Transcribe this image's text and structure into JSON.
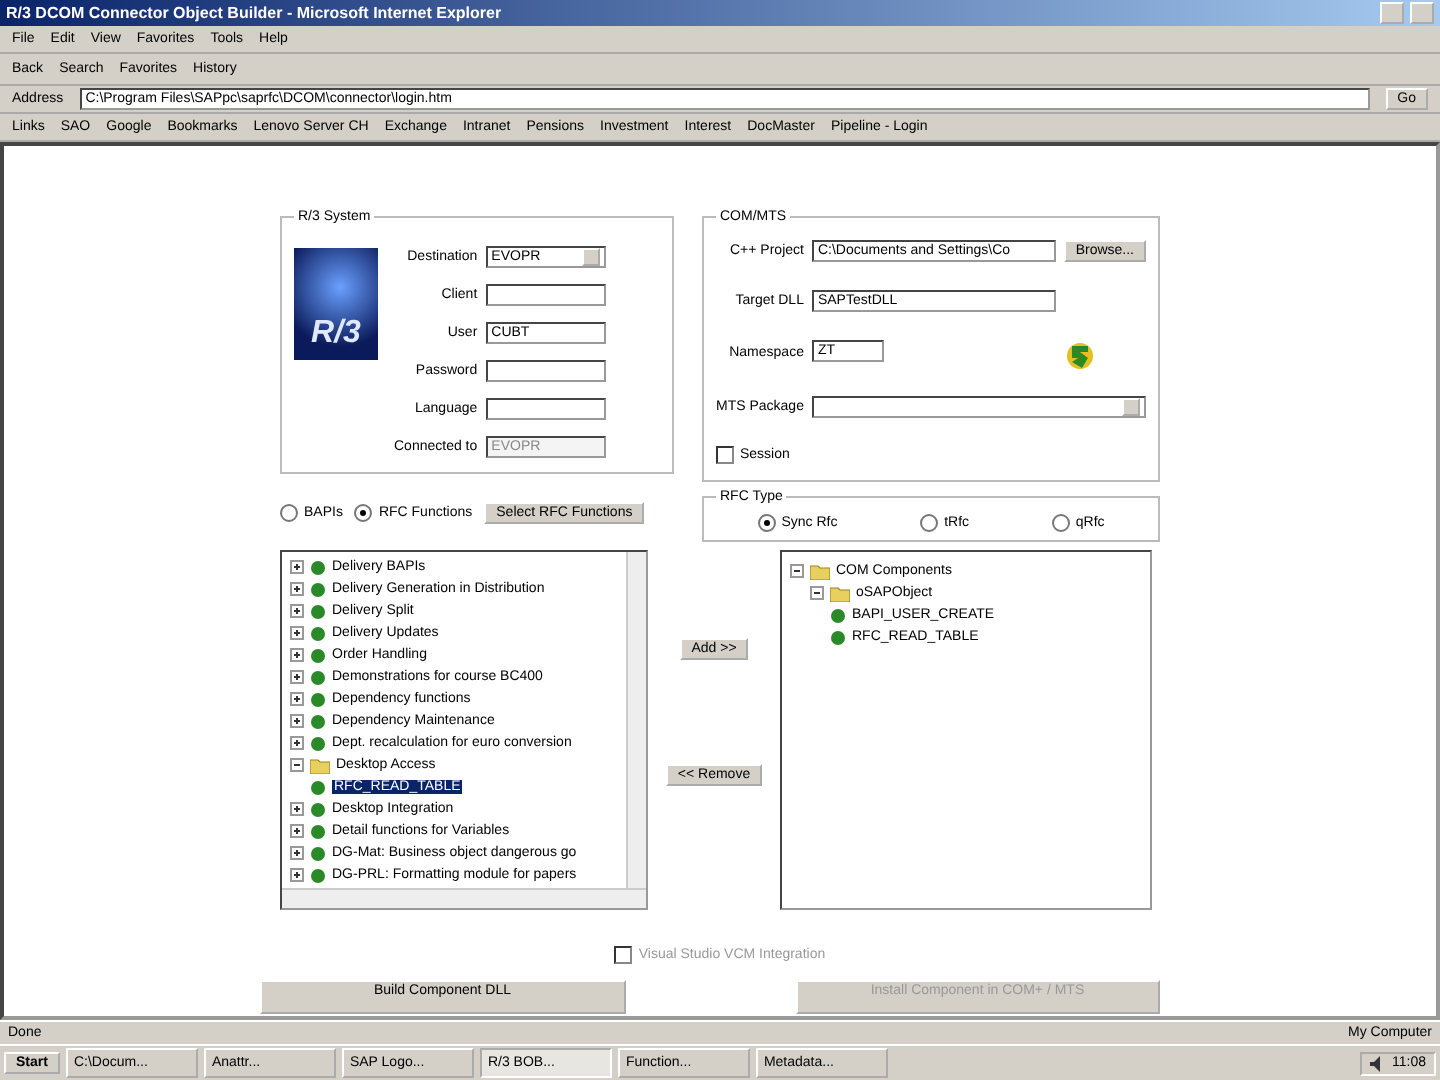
{
  "window": {
    "title": "R/3 DCOM Connector Object Builder - Microsoft Internet Explorer"
  },
  "menu": [
    "File",
    "Edit",
    "View",
    "Favorites",
    "Tools",
    "Help"
  ],
  "toolbar": [
    "Back",
    "Search",
    "Favorites",
    "History"
  ],
  "address": {
    "label": "Address",
    "value": "C:\\Program Files\\SAPpc\\saprfc\\DCOM\\connector\\login.htm",
    "go": "Go"
  },
  "links": [
    "Links",
    "SAO",
    "Google",
    "Bookmarks",
    "Lenovo Server CH",
    "Exchange",
    "Intranet",
    "Pensions",
    "Investment",
    "Interest",
    "DocMaster",
    "Pipeline - Login"
  ],
  "r3_system": {
    "title": "R/3 System",
    "logo_text": "R/3",
    "fields": [
      {
        "kind": "select",
        "label": "Destination",
        "value": "EVOPR"
      },
      {
        "kind": "text",
        "label": "Client"
      },
      {
        "kind": "text",
        "label": "User",
        "value": "CUBT"
      },
      {
        "kind": "text",
        "label": "Password"
      },
      {
        "kind": "text",
        "label": "Language"
      },
      {
        "kind": "readonly",
        "label": "Connected to",
        "value": "EVOPR"
      }
    ]
  },
  "com_mts": {
    "title": "COM/MTS",
    "project": {
      "label": "C++ Project",
      "value": "C:\\Documents and Settings\\Co",
      "button": "Browse..."
    },
    "target": {
      "label": "Target DLL",
      "value": "SAPTestDLL"
    },
    "namespace": {
      "label": "Namespace",
      "value": "ZT"
    },
    "package": {
      "label": "MTS Package"
    },
    "session": {
      "label": "Session",
      "checked": false
    }
  },
  "source": [
    {
      "label": "BAPIs",
      "selected": false
    },
    {
      "label": "RFC Functions",
      "selected": true
    }
  ],
  "select_button": "Select RFC Functions",
  "rfc_type": {
    "title": "RFC Type",
    "options": [
      {
        "label": "Sync Rfc",
        "selected": true
      },
      {
        "label": "tRfc",
        "selected": false
      },
      {
        "label": "qRfc",
        "selected": false
      }
    ]
  },
  "function_tree": [
    {
      "label": "Delivery BAPIs",
      "expanded": false
    },
    {
      "label": "Delivery Generation in Distribution",
      "expanded": false
    },
    {
      "label": "Delivery Split",
      "expanded": false
    },
    {
      "label": "Delivery Updates",
      "expanded": false
    },
    {
      "label": "Order Handling",
      "expanded": false
    },
    {
      "label": "Demonstrations for course BC400",
      "expanded": false
    },
    {
      "label": "Dependency functions",
      "expanded": false
    },
    {
      "label": "Dependency Maintenance",
      "expanded": false
    },
    {
      "label": "Dept. recalculation for euro conversion",
      "expanded": false
    },
    {
      "label": "Desktop Access",
      "expanded": true,
      "children": [
        {
          "label": "RFC_READ_TABLE",
          "selected": true
        }
      ]
    },
    {
      "label": "Desktop Integration",
      "expanded": false
    },
    {
      "label": "Detail functions for Variables",
      "expanded": false
    },
    {
      "label": "DG-Mat: Business object dangerous go",
      "expanded": false
    },
    {
      "label": "DG-PRL: Formatting module for papers",
      "expanded": false
    }
  ],
  "add_button": "Add >>",
  "remove_button": "<< Remove",
  "component_tree": [
    {
      "label": "COM Components",
      "expanded": true,
      "children": [
        {
          "label": "oSAPObject",
          "expanded": true,
          "children": [
            {
              "label": "BAPI_USER_CREATE"
            },
            {
              "label": "RFC_READ_TABLE"
            }
          ]
        }
      ]
    }
  ],
  "vs_integration": {
    "label": "Visual Studio VCM Integration",
    "checked": false,
    "disabled": true
  },
  "build_button": {
    "label": "Build Component DLL",
    "disabled": false
  },
  "install_button": {
    "label": "Install Component in COM+ / MTS",
    "disabled": true
  },
  "status_bar": {
    "text": "Done",
    "zone": "My Computer"
  },
  "taskbar": {
    "start": "Start",
    "tasks": [
      {
        "label": "C:\\Docum...",
        "selected": false
      },
      {
        "label": "Anattr...",
        "selected": false
      },
      {
        "label": "SAP Logo...",
        "selected": false
      },
      {
        "label": "R/3 BOB...",
        "selected": true
      },
      {
        "label": "Function...",
        "selected": false
      },
      {
        "label": "Metadata...",
        "selected": false
      }
    ],
    "clock": "11:08"
  }
}
